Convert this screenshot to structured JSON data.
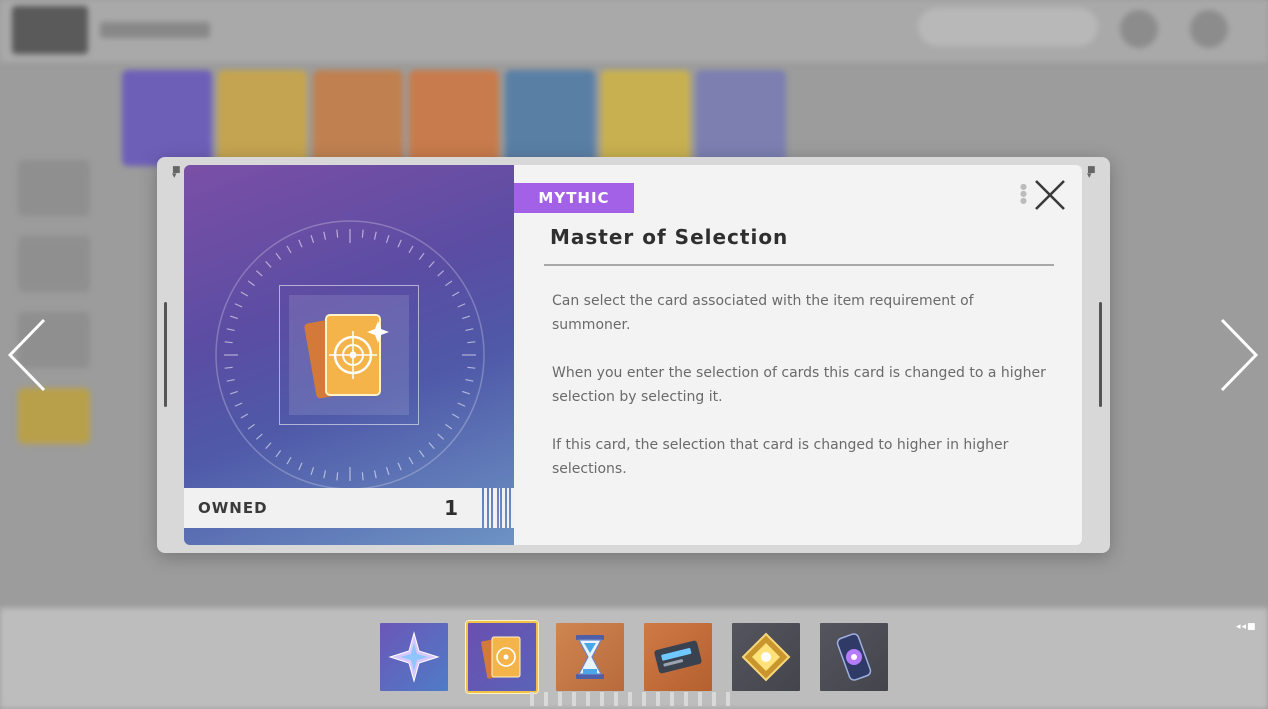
{
  "item": {
    "rarity": "MYTHIC",
    "title": "Master of Selection",
    "description": [
      "Can select the card associated with the item requirement of summoner.",
      "When you enter the selection of cards this card is changed to a higher selection by selecting it.",
      "If this card, the selection that card is changed to higher in higher selections."
    ],
    "owned_label": "OWNED",
    "owned_count": "1"
  },
  "controls": {
    "close_icon": "close-icon",
    "prev_icon": "chevron-left-icon",
    "next_icon": "chevron-right-icon"
  },
  "strip": {
    "items": [
      {
        "icon": "crystal-star-icon",
        "bg": "#6b56b8",
        "selected": false
      },
      {
        "icon": "target-cards-icon",
        "bg": "#5d54b0",
        "selected": true
      },
      {
        "icon": "hourglass-icon",
        "bg": "#c87a47",
        "selected": false
      },
      {
        "icon": "ticket-card-icon",
        "bg": "#c66e3f",
        "selected": false
      },
      {
        "icon": "gold-gem-icon",
        "bg": "#4d4d57",
        "selected": false
      },
      {
        "icon": "energy-capsule-icon",
        "bg": "#4d4d57",
        "selected": false
      }
    ]
  },
  "colors": {
    "rarity": "#a361e8",
    "selected_border": "#f0c24a",
    "panel": "#f3f3f3"
  }
}
